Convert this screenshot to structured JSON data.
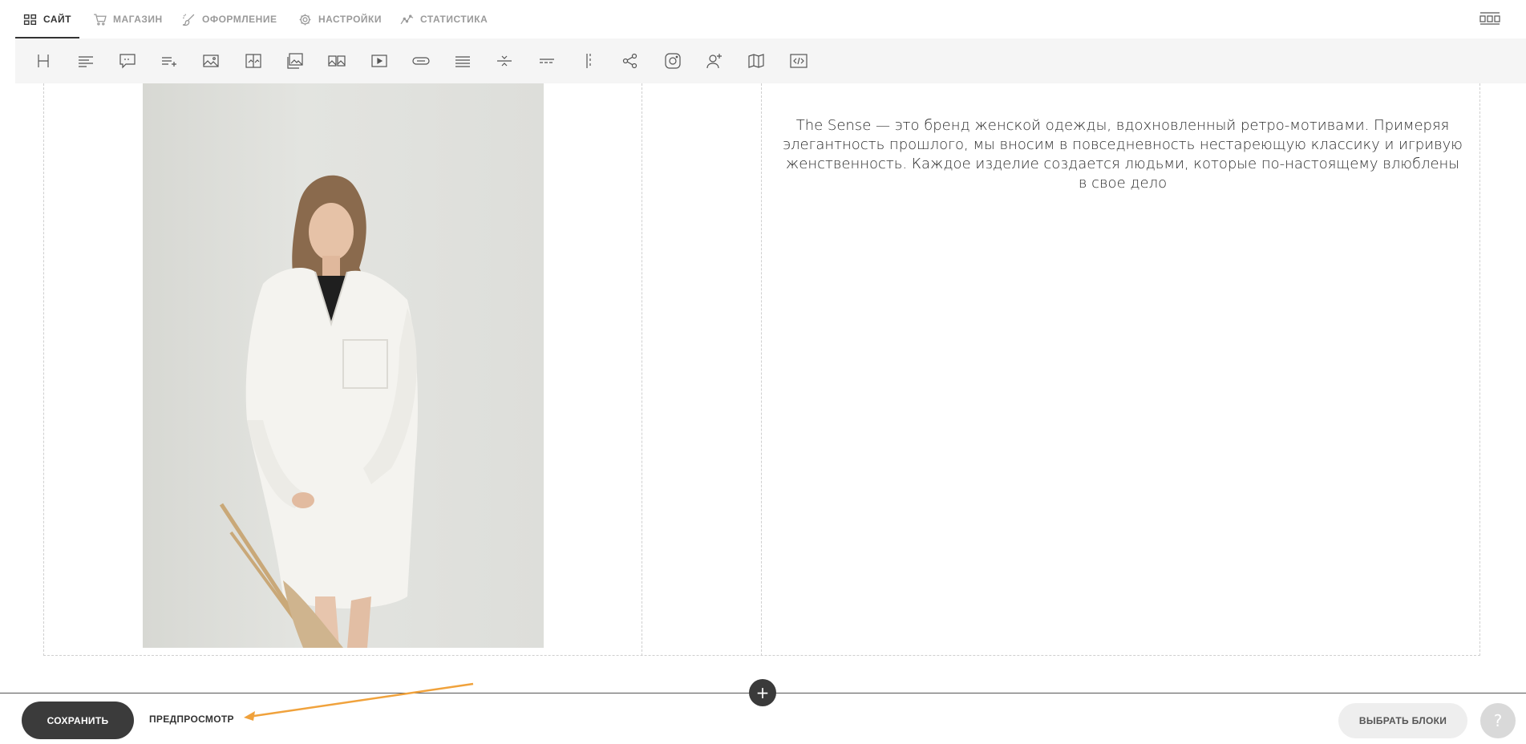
{
  "nav": {
    "items": [
      {
        "label": "САЙТ",
        "icon": "grid-icon",
        "active": true
      },
      {
        "label": "МАГАЗИН",
        "icon": "cart-icon",
        "active": false
      },
      {
        "label": "ОФОРМЛЕНИЕ",
        "icon": "brush-icon",
        "active": false
      },
      {
        "label": "НАСТРОЙКИ",
        "icon": "gear-icon",
        "active": false
      },
      {
        "label": "СТАТИСТИКА",
        "icon": "stats-icon",
        "active": false
      }
    ],
    "right_icon": "blocks-icon"
  },
  "toolbar": {
    "tools": [
      "heading-icon",
      "text-icon",
      "quote-icon",
      "list-icon",
      "image-icon",
      "image-compare-icon",
      "image-text-icon",
      "gallery-icon",
      "video-icon",
      "button-icon",
      "lines-icon",
      "divider-icon",
      "dashed-divider-icon",
      "spacer-icon",
      "share-icon",
      "instagram-icon",
      "subscribe-icon",
      "map-icon",
      "code-icon"
    ]
  },
  "content": {
    "text": "The Sense — это бренд женской одежды, вдохновленный ретро-мотивами. Примеряя элегантность прошлого, мы вносим в повседневность нестареющую классику и игривую женственность. Каждое изделие создается людьми, которые по-настоящему влюблены в свое дело"
  },
  "footer": {
    "save_label": "СОХРАНИТЬ",
    "preview_label": "ПРЕДПРОСМОТР",
    "choose_blocks_label": "ВЫБРАТЬ БЛОКИ",
    "help_label": "?",
    "add_label": "+"
  },
  "colors": {
    "accent_dark": "#3b3b3b",
    "annotation_arrow": "#f0a23c"
  }
}
